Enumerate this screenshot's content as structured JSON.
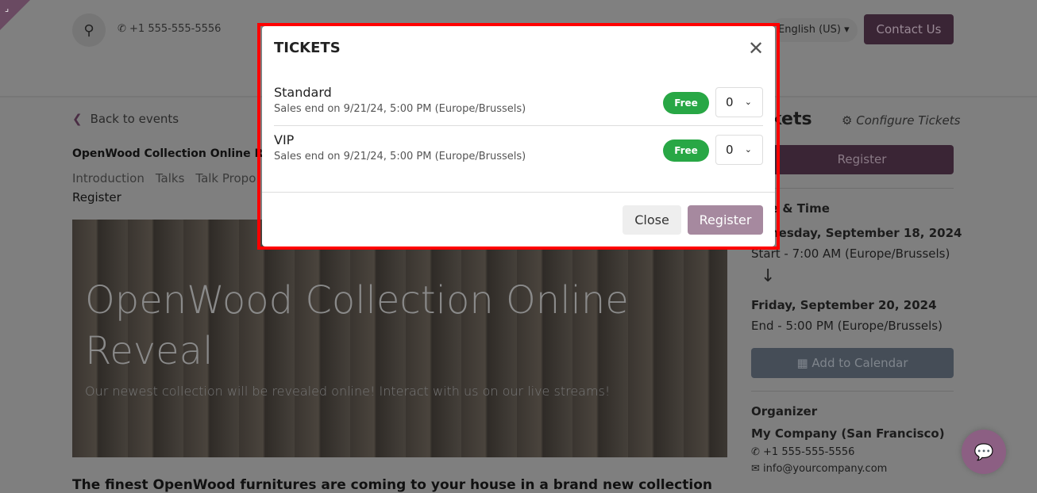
{
  "header": {
    "phone": "+1 555-555-5556",
    "language": "English (US)",
    "contact_label": "Contact Us"
  },
  "main": {
    "back_label": "Back to events",
    "event_title": "OpenWood Collection Online Re",
    "nav": [
      "Introduction",
      "Talks",
      "Talk Propo"
    ],
    "register_link": "Register",
    "hero_title": "OpenWood Collection Online Reveal",
    "hero_subtitle": "Our newest collection will be revealed online! Interact with us on our live streams!",
    "finest": "The finest OpenWood furnitures are coming to your house in a brand new collection"
  },
  "sidebar": {
    "tickets_title": "kets",
    "configure_label": "Configure Tickets",
    "register_label": "Register",
    "date_time_label": "e & Time",
    "start_date": "nesday, September 18, 2024",
    "start_time": "Start - 7:00 AM (Europe/Brussels)",
    "end_date": "Friday, September 20, 2024",
    "end_time": "End - 5:00 PM (Europe/Brussels)",
    "calendar_label": "Add to Calendar",
    "organizer_label": "Organizer",
    "organizer_name": "My Company (San Francisco)",
    "organizer_phone": "+1 555-555-5556",
    "organizer_email": "info@yourcompany.com"
  },
  "modal": {
    "title": "TICKETS",
    "tickets": [
      {
        "name": "Standard",
        "sales_end": "Sales end on 9/21/24, 5:00 PM (Europe/Brussels)",
        "price": "Free",
        "quantity": "0"
      },
      {
        "name": "VIP",
        "sales_end": "Sales end on 9/21/24, 5:00 PM (Europe/Brussels)",
        "price": "Free",
        "quantity": "0"
      }
    ],
    "close_label": "Close",
    "register_label": "Register"
  },
  "colors": {
    "brand": "#3a2535",
    "free_badge": "#28a745",
    "highlight": "#ff0000"
  }
}
